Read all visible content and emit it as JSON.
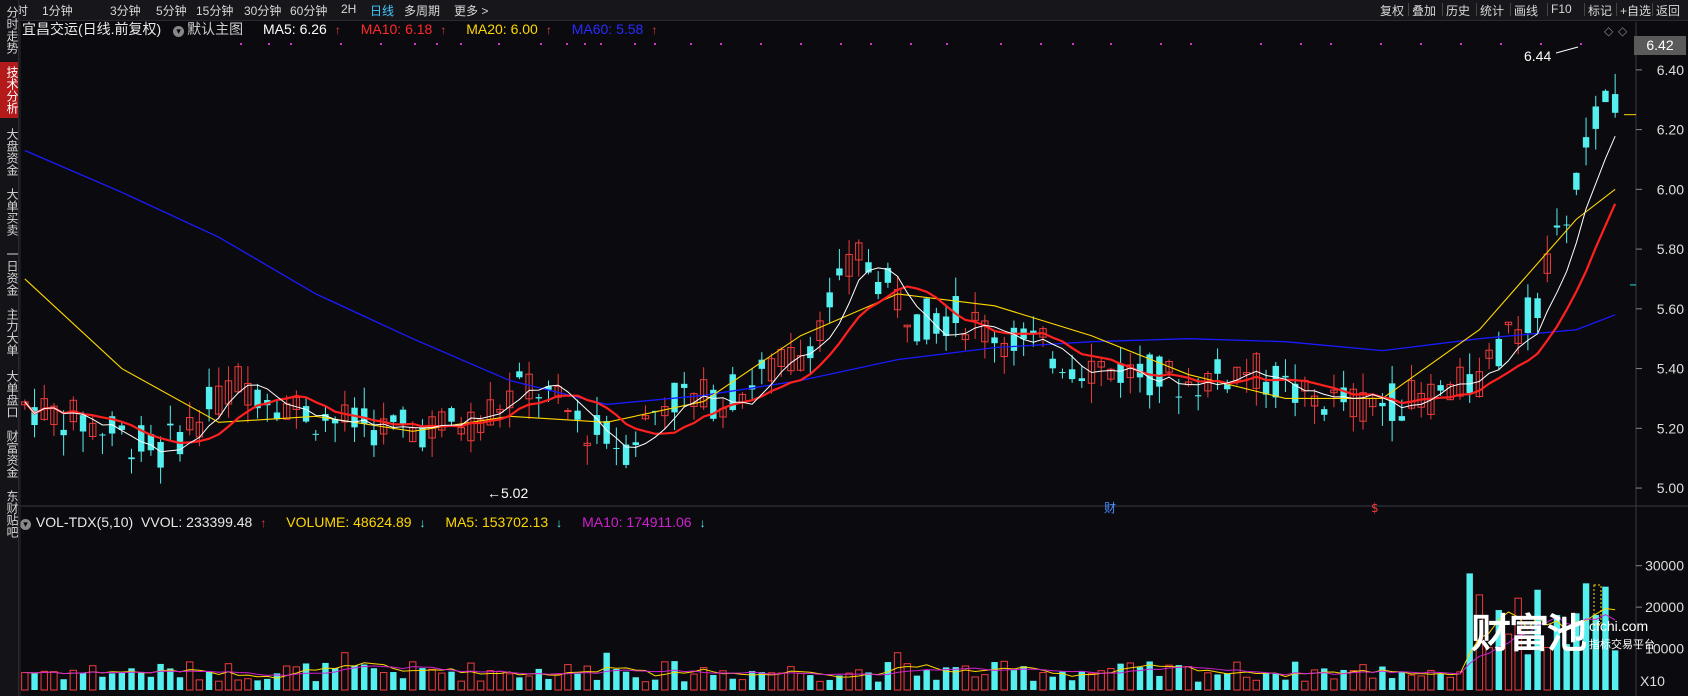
{
  "toolbar": {
    "periods": [
      "分时",
      "1分钟",
      "3分钟",
      "5分钟",
      "15分钟",
      "30分钟",
      "60分钟",
      "2H",
      "日线",
      "多周期",
      "更多 >"
    ],
    "active_period": "日线",
    "right_buttons": [
      "复权",
      "叠加",
      "历史",
      "统计",
      "画线",
      "F10",
      "标记",
      "+自选",
      "返回"
    ]
  },
  "left_tabs": [
    "分时走势",
    "技术分析",
    "大盘资金",
    "大单买卖",
    "一日资金",
    "主力大单",
    "大单盘口",
    "财富资金",
    "东财贴吧"
  ],
  "active_left_tab": "技术分析",
  "main_legend": {
    "title": "宜昌交运(日线.前复权)",
    "chart_select": "默认主图",
    "ma5": "MA5: 6.26",
    "ma10": "MA10: 6.18",
    "ma20": "MA20: 6.00",
    "ma60": "MA60: 5.58",
    "arrow_up": "↑",
    "arrow_down": "↓"
  },
  "vol_legend": {
    "title": "VOL-TDX(5,10)",
    "vvol": "VVOL: 233399.48",
    "volume": "VOLUME: 48624.89",
    "ma5": "MA5: 153702.13",
    "ma10": "MA10: 174911.06"
  },
  "annotations": {
    "high": "6.44",
    "low": "5.02",
    "current_price": "6.42",
    "event_1": "财",
    "event_2": "$",
    "vol_unit": "X10"
  },
  "watermark": {
    "brand": "财富池",
    "domain": "cfchi.com",
    "slogan": "指标交易平台"
  },
  "colors": {
    "up": "#ef3b3b",
    "down": "#54f0f0",
    "ma5": "#ffffff",
    "ma10": "#ff2020",
    "ma20": "#ffd700",
    "ma60": "#1a1aff",
    "vol_ma5": "#ffd700",
    "vol_ma10": "#d020d0"
  },
  "chart_data": {
    "type": "candlestick",
    "ylim_price": [
      4.96,
      6.5
    ],
    "yticks_price": [
      5.0,
      5.2,
      5.4,
      5.6,
      5.8,
      6.0,
      6.2,
      6.4
    ],
    "ylim_volume": [
      0,
      35000
    ],
    "yticks_volume": [
      10000,
      20000,
      30000
    ],
    "ma_end_values": {
      "MA5": 6.26,
      "MA10": 6.18,
      "MA20": 6.0,
      "MA60": 5.58
    },
    "ma60_path": [
      [
        0,
        6.13
      ],
      [
        10,
        5.99
      ],
      [
        20,
        5.84
      ],
      [
        30,
        5.65
      ],
      [
        40,
        5.5
      ],
      [
        50,
        5.36
      ],
      [
        60,
        5.28
      ],
      [
        70,
        5.31
      ],
      [
        80,
        5.36
      ],
      [
        90,
        5.43
      ],
      [
        100,
        5.47
      ],
      [
        110,
        5.49
      ],
      [
        120,
        5.5
      ],
      [
        130,
        5.49
      ],
      [
        140,
        5.46
      ],
      [
        150,
        5.5
      ],
      [
        160,
        5.53
      ],
      [
        164,
        5.58
      ]
    ],
    "ma20_path": [
      [
        0,
        5.7
      ],
      [
        10,
        5.4
      ],
      [
        20,
        5.22
      ],
      [
        30,
        5.24
      ],
      [
        40,
        5.19
      ],
      [
        50,
        5.24
      ],
      [
        60,
        5.22
      ],
      [
        70,
        5.29
      ],
      [
        80,
        5.51
      ],
      [
        90,
        5.65
      ],
      [
        100,
        5.61
      ],
      [
        110,
        5.51
      ],
      [
        120,
        5.38
      ],
      [
        130,
        5.3
      ],
      [
        140,
        5.3
      ],
      [
        150,
        5.53
      ],
      [
        160,
        5.9
      ],
      [
        164,
        6.0
      ]
    ]
  }
}
